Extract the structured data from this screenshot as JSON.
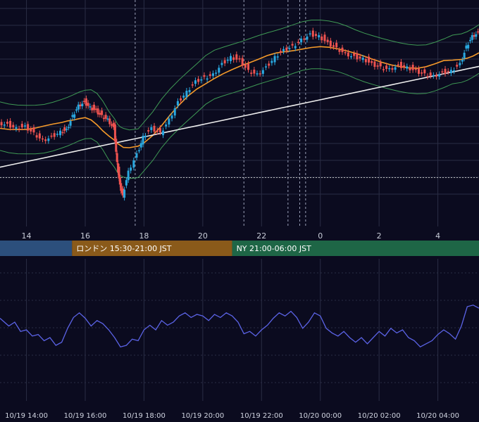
{
  "chart_data": [
    {
      "type": "line",
      "panel": "price",
      "indicators": [
        "candlestick",
        "bollinger-bands",
        "moving-average-orange",
        "moving-average-white"
      ],
      "x_ticks": [
        "14",
        "16",
        "18",
        "20",
        "22",
        "0",
        "2",
        "4"
      ],
      "x_tick_hours": [
        14,
        16,
        18,
        20,
        22,
        24,
        26,
        28
      ],
      "x_range_hours": [
        13.1,
        29.4
      ],
      "y_range": [
        0,
        100
      ],
      "reference_line_y": 16,
      "vertical_marker_hours": [
        17.7,
        21.4,
        22.9,
        23.3,
        23.5
      ],
      "price_series": [
        {
          "h": 13.1,
          "v": 48
        },
        {
          "h": 13.4,
          "v": 47
        },
        {
          "h": 13.7,
          "v": 45
        },
        {
          "h": 14.0,
          "v": 46
        },
        {
          "h": 14.3,
          "v": 42
        },
        {
          "h": 14.6,
          "v": 38
        },
        {
          "h": 14.9,
          "v": 40
        },
        {
          "h": 15.2,
          "v": 43
        },
        {
          "h": 15.4,
          "v": 44
        },
        {
          "h": 15.6,
          "v": 52
        },
        {
          "h": 15.8,
          "v": 58
        },
        {
          "h": 16.0,
          "v": 60
        },
        {
          "h": 16.2,
          "v": 57
        },
        {
          "h": 16.4,
          "v": 55
        },
        {
          "h": 16.6,
          "v": 52
        },
        {
          "h": 16.8,
          "v": 50
        },
        {
          "h": 17.0,
          "v": 45
        },
        {
          "h": 17.1,
          "v": 25
        },
        {
          "h": 17.2,
          "v": 12
        },
        {
          "h": 17.3,
          "v": 6
        },
        {
          "h": 17.5,
          "v": 20
        },
        {
          "h": 17.8,
          "v": 30
        },
        {
          "h": 18.0,
          "v": 40
        },
        {
          "h": 18.3,
          "v": 45
        },
        {
          "h": 18.6,
          "v": 42
        },
        {
          "h": 18.9,
          "v": 50
        },
        {
          "h": 19.2,
          "v": 60
        },
        {
          "h": 19.5,
          "v": 66
        },
        {
          "h": 19.8,
          "v": 72
        },
        {
          "h": 20.1,
          "v": 74
        },
        {
          "h": 20.4,
          "v": 76
        },
        {
          "h": 20.7,
          "v": 82
        },
        {
          "h": 21.0,
          "v": 86
        },
        {
          "h": 21.3,
          "v": 84
        },
        {
          "h": 21.6,
          "v": 78
        },
        {
          "h": 21.9,
          "v": 76
        },
        {
          "h": 22.2,
          "v": 80
        },
        {
          "h": 22.5,
          "v": 86
        },
        {
          "h": 22.8,
          "v": 90
        },
        {
          "h": 23.1,
          "v": 92
        },
        {
          "h": 23.4,
          "v": 96
        },
        {
          "h": 23.7,
          "v": 99
        },
        {
          "h": 24.0,
          "v": 98
        },
        {
          "h": 24.3,
          "v": 94
        },
        {
          "h": 24.6,
          "v": 91
        },
        {
          "h": 24.9,
          "v": 88
        },
        {
          "h": 25.2,
          "v": 86
        },
        {
          "h": 25.5,
          "v": 85
        },
        {
          "h": 25.8,
          "v": 82
        },
        {
          "h": 26.1,
          "v": 80
        },
        {
          "h": 26.4,
          "v": 79
        },
        {
          "h": 26.7,
          "v": 81
        },
        {
          "h": 27.0,
          "v": 80
        },
        {
          "h": 27.3,
          "v": 78
        },
        {
          "h": 27.6,
          "v": 76
        },
        {
          "h": 27.9,
          "v": 75
        },
        {
          "h": 28.2,
          "v": 77
        },
        {
          "h": 28.5,
          "v": 78
        },
        {
          "h": 28.8,
          "v": 82
        },
        {
          "h": 29.0,
          "v": 92
        },
        {
          "h": 29.2,
          "v": 98
        },
        {
          "h": 29.4,
          "v": 100
        }
      ]
    },
    {
      "type": "line",
      "panel": "oscillator",
      "x_tick_labels": [
        "10/19 14:00",
        "10/19 16:00",
        "10/19 18:00",
        "10/19 20:00",
        "10/19 22:00",
        "10/20 00:00",
        "10/20 02:00",
        "10/20 04:00"
      ],
      "y_range": [
        0,
        100
      ],
      "series": [
        {
          "h": 13.1,
          "v": 55
        },
        {
          "h": 13.4,
          "v": 45
        },
        {
          "h": 13.6,
          "v": 50
        },
        {
          "h": 13.8,
          "v": 38
        },
        {
          "h": 14.0,
          "v": 40
        },
        {
          "h": 14.2,
          "v": 32
        },
        {
          "h": 14.4,
          "v": 34
        },
        {
          "h": 14.6,
          "v": 26
        },
        {
          "h": 14.8,
          "v": 30
        },
        {
          "h": 15.0,
          "v": 20
        },
        {
          "h": 15.2,
          "v": 24
        },
        {
          "h": 15.4,
          "v": 42
        },
        {
          "h": 15.6,
          "v": 56
        },
        {
          "h": 15.8,
          "v": 62
        },
        {
          "h": 16.0,
          "v": 55
        },
        {
          "h": 16.2,
          "v": 45
        },
        {
          "h": 16.4,
          "v": 52
        },
        {
          "h": 16.6,
          "v": 48
        },
        {
          "h": 16.8,
          "v": 40
        },
        {
          "h": 17.0,
          "v": 30
        },
        {
          "h": 17.2,
          "v": 18
        },
        {
          "h": 17.4,
          "v": 20
        },
        {
          "h": 17.6,
          "v": 28
        },
        {
          "h": 17.8,
          "v": 26
        },
        {
          "h": 18.0,
          "v": 40
        },
        {
          "h": 18.2,
          "v": 46
        },
        {
          "h": 18.4,
          "v": 40
        },
        {
          "h": 18.6,
          "v": 52
        },
        {
          "h": 18.8,
          "v": 46
        },
        {
          "h": 19.0,
          "v": 50
        },
        {
          "h": 19.2,
          "v": 58
        },
        {
          "h": 19.4,
          "v": 62
        },
        {
          "h": 19.6,
          "v": 56
        },
        {
          "h": 19.8,
          "v": 60
        },
        {
          "h": 20.0,
          "v": 58
        },
        {
          "h": 20.2,
          "v": 52
        },
        {
          "h": 20.4,
          "v": 60
        },
        {
          "h": 20.6,
          "v": 56
        },
        {
          "h": 20.8,
          "v": 62
        },
        {
          "h": 21.0,
          "v": 58
        },
        {
          "h": 21.2,
          "v": 50
        },
        {
          "h": 21.4,
          "v": 35
        },
        {
          "h": 21.6,
          "v": 38
        },
        {
          "h": 21.8,
          "v": 32
        },
        {
          "h": 22.0,
          "v": 40
        },
        {
          "h": 22.2,
          "v": 46
        },
        {
          "h": 22.4,
          "v": 55
        },
        {
          "h": 22.6,
          "v": 62
        },
        {
          "h": 22.8,
          "v": 58
        },
        {
          "h": 23.0,
          "v": 64
        },
        {
          "h": 23.2,
          "v": 56
        },
        {
          "h": 23.4,
          "v": 42
        },
        {
          "h": 23.6,
          "v": 50
        },
        {
          "h": 23.8,
          "v": 62
        },
        {
          "h": 24.0,
          "v": 58
        },
        {
          "h": 24.2,
          "v": 42
        },
        {
          "h": 24.4,
          "v": 36
        },
        {
          "h": 24.6,
          "v": 32
        },
        {
          "h": 24.8,
          "v": 38
        },
        {
          "h": 25.0,
          "v": 30
        },
        {
          "h": 25.2,
          "v": 24
        },
        {
          "h": 25.4,
          "v": 30
        },
        {
          "h": 25.6,
          "v": 22
        },
        {
          "h": 25.8,
          "v": 30
        },
        {
          "h": 26.0,
          "v": 38
        },
        {
          "h": 26.2,
          "v": 32
        },
        {
          "h": 26.4,
          "v": 42
        },
        {
          "h": 26.6,
          "v": 36
        },
        {
          "h": 26.8,
          "v": 40
        },
        {
          "h": 27.0,
          "v": 30
        },
        {
          "h": 27.2,
          "v": 26
        },
        {
          "h": 27.4,
          "v": 18
        },
        {
          "h": 27.6,
          "v": 22
        },
        {
          "h": 27.8,
          "v": 26
        },
        {
          "h": 28.0,
          "v": 34
        },
        {
          "h": 28.2,
          "v": 40
        },
        {
          "h": 28.4,
          "v": 35
        },
        {
          "h": 28.6,
          "v": 28
        },
        {
          "h": 28.8,
          "v": 45
        },
        {
          "h": 29.0,
          "v": 70
        },
        {
          "h": 29.2,
          "v": 72
        },
        {
          "h": 29.4,
          "v": 68
        }
      ]
    }
  ],
  "sessions": [
    {
      "label": "",
      "color": "#2c4f7c",
      "start_hour": 13.1,
      "end_hour": 15.55
    },
    {
      "label": "ロンドン 15:30-21:00 JST",
      "color": "#8a5a1a",
      "start_hour": 15.55,
      "end_hour": 21.0
    },
    {
      "label": "NY 21:00-06:00 JST",
      "color": "#1e6646",
      "start_hour": 21.0,
      "end_hour": 29.4
    }
  ],
  "colors": {
    "background": "#0b0b1f",
    "grid": "#2a2d45",
    "candle_up": "#29a8e0",
    "candle_down": "#ef5350",
    "band": "#3f9a55",
    "ma_orange": "#f59a2a",
    "ma_white": "#eeeeee",
    "oscillator": "#5b63e6",
    "dotted_ref": "#bbbbbb"
  }
}
